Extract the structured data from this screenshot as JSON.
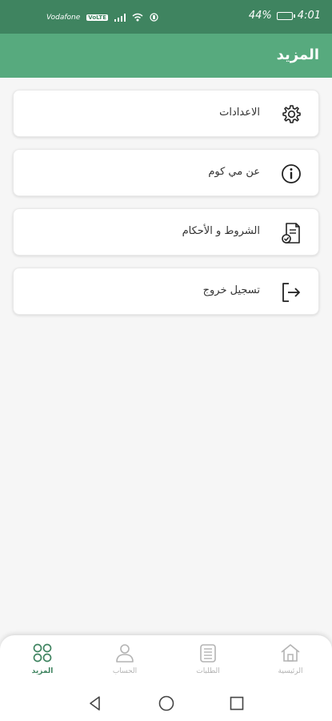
{
  "status_bar": {
    "time": "4:01",
    "battery_percent": "44%",
    "carrier": "Vodafone",
    "network_badge": "VoLTE"
  },
  "header": {
    "title": "المزيد"
  },
  "menu": {
    "items": [
      {
        "label": "الاعدادات",
        "icon": "gear-icon"
      },
      {
        "label": "عن مي كوم",
        "icon": "info-icon"
      },
      {
        "label": "الشروط و الأحكام",
        "icon": "document-check-icon"
      },
      {
        "label": "تسجيل خروج",
        "icon": "logout-icon"
      }
    ]
  },
  "bottom_nav": {
    "items": [
      {
        "label": "الرئيسية",
        "icon": "home-icon",
        "active": false
      },
      {
        "label": "الطلبات",
        "icon": "orders-icon",
        "active": false
      },
      {
        "label": "الحساب",
        "icon": "user-icon",
        "active": false
      },
      {
        "label": "المزيد",
        "icon": "more-grid-icon",
        "active": true
      }
    ]
  },
  "colors": {
    "status_bar": "#3f8460",
    "app_bar": "#57aa7e",
    "active": "#3f8460",
    "inactive": "#b3b3b3"
  }
}
